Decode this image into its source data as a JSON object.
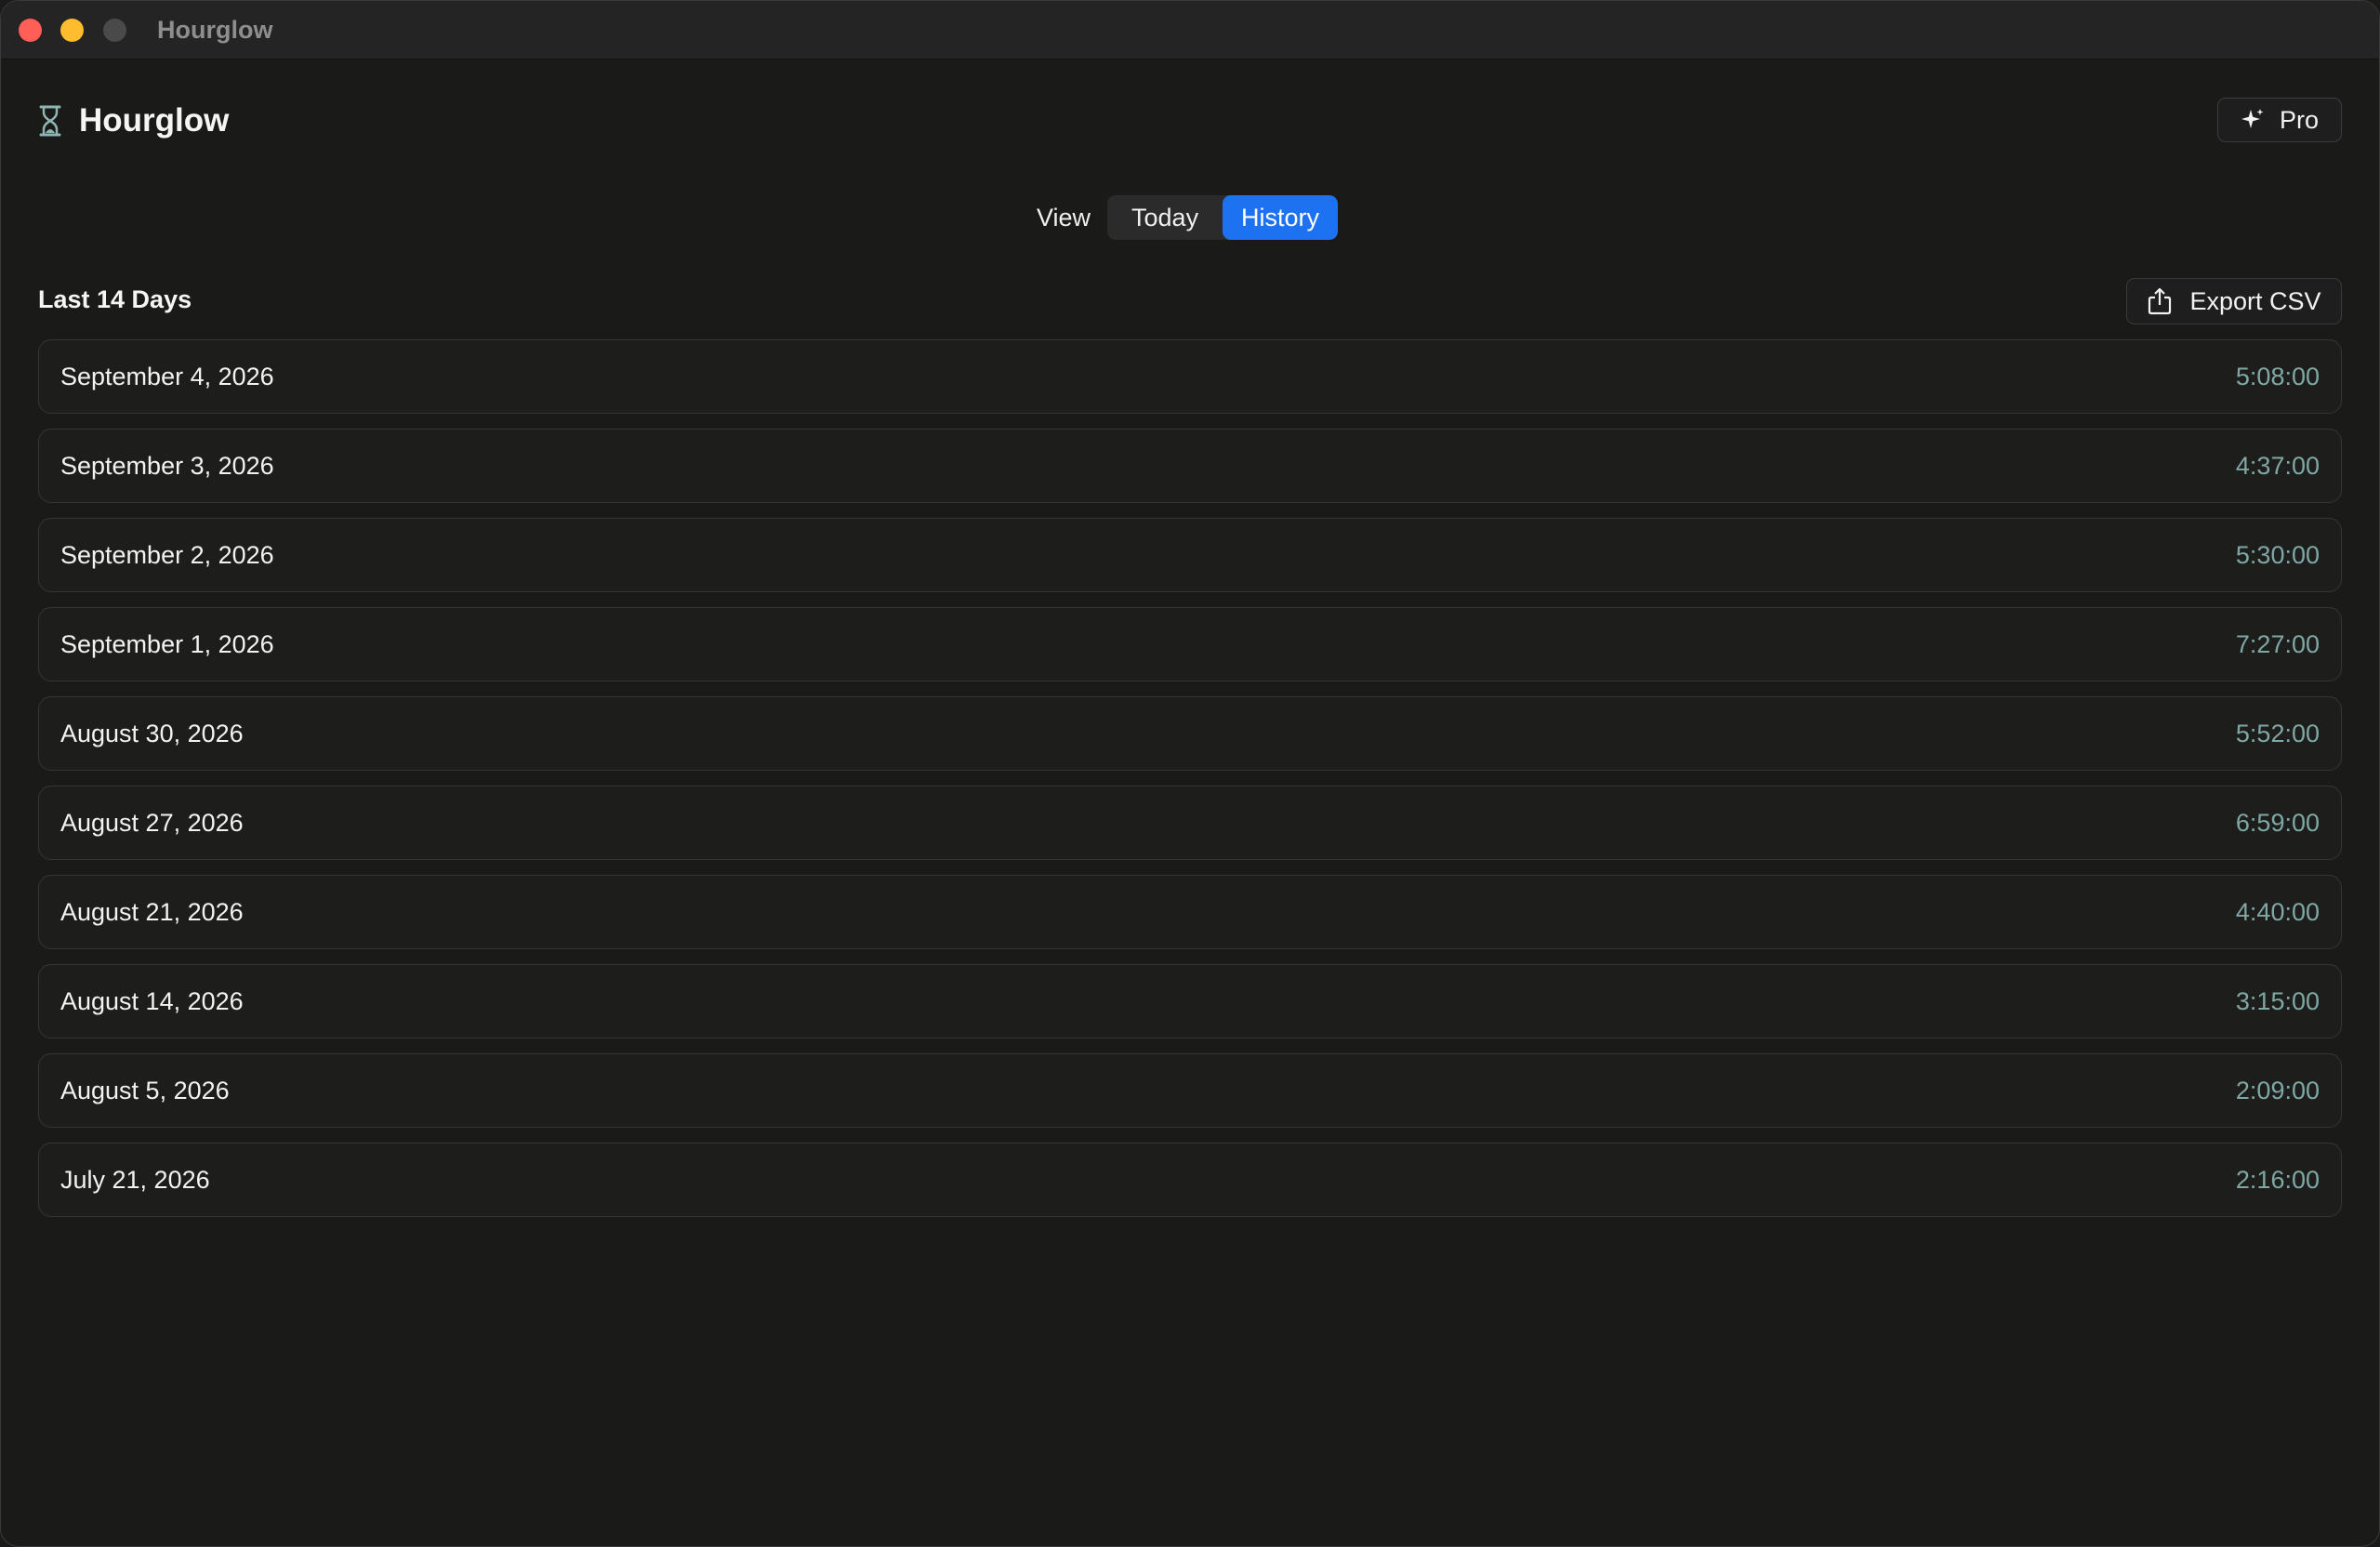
{
  "window": {
    "title": "Hourglow"
  },
  "header": {
    "app_name": "Hourglow",
    "pro_label": "Pro"
  },
  "view_control": {
    "label": "View",
    "options": [
      "Today",
      "History"
    ],
    "selected": "History"
  },
  "history": {
    "section_title": "Last 14 Days",
    "export_label": "Export CSV",
    "entries": [
      {
        "date": "September 4, 2026",
        "duration": "5:08:00"
      },
      {
        "date": "September 3, 2026",
        "duration": "4:37:00"
      },
      {
        "date": "September 2, 2026",
        "duration": "5:30:00"
      },
      {
        "date": "September 1, 2026",
        "duration": "7:27:00"
      },
      {
        "date": "August 30, 2026",
        "duration": "5:52:00"
      },
      {
        "date": "August 27, 2026",
        "duration": "6:59:00"
      },
      {
        "date": "August 21, 2026",
        "duration": "4:40:00"
      },
      {
        "date": "August 14, 2026",
        "duration": "3:15:00"
      },
      {
        "date": "August 5, 2026",
        "duration": "2:09:00"
      },
      {
        "date": "July 21, 2026",
        "duration": "2:16:00"
      }
    ]
  },
  "colors": {
    "accent": "#1d72f2",
    "duration_text": "#7fa8a4",
    "background": "#1a1a19"
  }
}
